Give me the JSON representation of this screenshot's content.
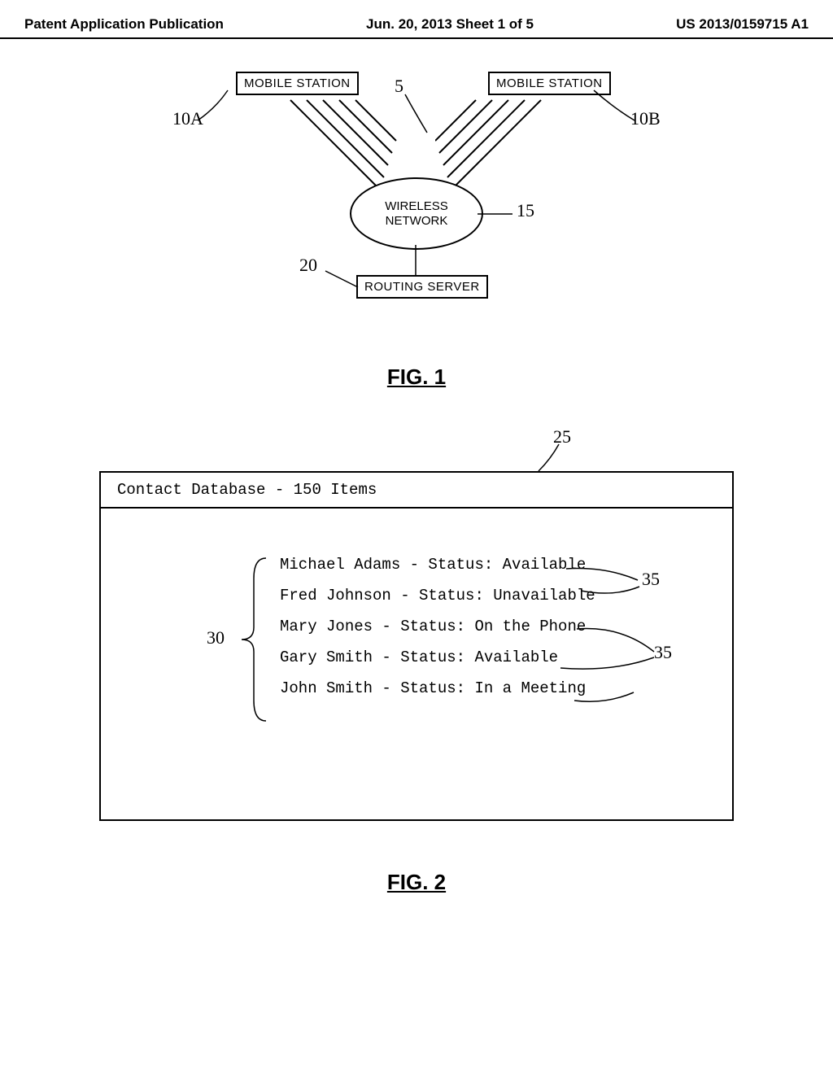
{
  "header": {
    "left": "Patent Application Publication",
    "center": "Jun. 20, 2013  Sheet 1 of 5",
    "right": "US 2013/0159715 A1"
  },
  "fig1": {
    "caption": "FIG. 1",
    "mobileA": "MOBILE STATION",
    "mobileB": "MOBILE STATION",
    "wireless": "WIRELESS\nNETWORK",
    "routing": "ROUTING SERVER",
    "ref5": "5",
    "ref10A": "10A",
    "ref10B": "10B",
    "ref15": "15",
    "ref20": "20"
  },
  "fig2": {
    "caption": "FIG. 2",
    "title": "Contact Database - 150 Items",
    "contacts": [
      "Michael Adams - Status: Available",
      "Fred Johnson - Status: Unavailable",
      "Mary Jones - Status: On the Phone",
      "Gary Smith - Status: Available",
      "John Smith - Status: In a Meeting"
    ],
    "ref25": "25",
    "ref30": "30",
    "ref35a": "35",
    "ref35b": "35"
  }
}
